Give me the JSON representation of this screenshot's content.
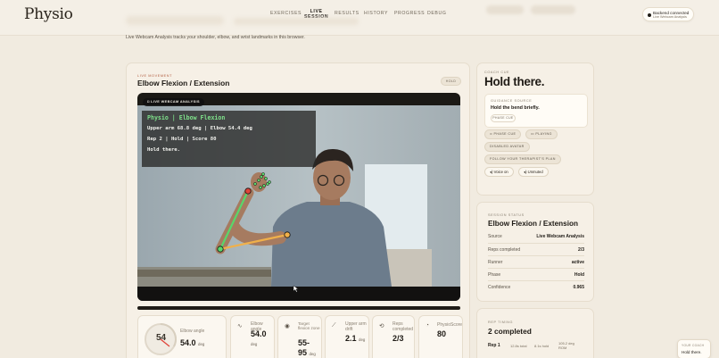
{
  "app": {
    "logo": "Physio"
  },
  "nav": {
    "items": [
      {
        "label": "EXERCISES"
      },
      {
        "label": "LIVE",
        "sub": "SESSION",
        "active": true
      },
      {
        "label": "RESULTS"
      },
      {
        "label": "HISTORY"
      },
      {
        "label": "PROGRESS"
      },
      {
        "label": "DEBUG"
      }
    ]
  },
  "backend_status": {
    "title": "Backend connected",
    "subtitle": "Live Webcam Analysis"
  },
  "intro_text": "Live Webcam Analysis tracks your shoulder, elbow, and wrist landmarks in this browser.",
  "movement": {
    "eyebrow": "LIVE MOVEMENT",
    "title": "Elbow Flexion / Extension",
    "badge": "HOLD"
  },
  "video": {
    "badge": "LIVE WEBCAM ANALYSIS",
    "overlay": {
      "title": "Physio | Elbow Flexion",
      "line1": "Upper arm 68.8 deg | Elbow 54.4 deg",
      "line2": "Rep 2 | Hold | Score 80",
      "line3": "Hold there."
    }
  },
  "metrics": {
    "elbow_angle": {
      "gauge_value": "54",
      "label": "Elbow angle",
      "value": "54.0",
      "unit": "deg"
    },
    "elbow_angle_2": {
      "label": "Elbow angle",
      "value": "54.0",
      "unit": "deg"
    },
    "target": {
      "label": "Target flexion zone",
      "value": "55-",
      "value2": "95",
      "unit": "deg"
    },
    "upper_arm_drift": {
      "label": "Upper arm drift",
      "value": "2.1",
      "unit": "deg"
    },
    "reps": {
      "label": "Reps completed",
      "value": "2/3"
    },
    "score": {
      "label": "PhysioScore",
      "value": "80"
    }
  },
  "coach": {
    "eyebrow": "COACH CUE",
    "cue": "Hold there.",
    "guidance_eyebrow": "GUIDANCE SOURCE",
    "guidance_text": "Hold the bend briefly.",
    "phase_pill": "PHASE CUE",
    "chips": {
      "phase_cue": "PHASE CUE",
      "playing": "PLAYING",
      "disabled_avatar": "DISABLED AVATAR",
      "follow_plan": "FOLLOW YOUR THERAPIST'S PLAN",
      "voice_on": "Voice on",
      "unmuted": "Unmuted"
    }
  },
  "session": {
    "eyebrow": "SESSION STATUS",
    "title": "Elbow Flexion / Extension",
    "rows": [
      {
        "k": "Source",
        "v": "Live Webcam Analysis"
      },
      {
        "k": "Reps completed",
        "v": "2/3"
      },
      {
        "k": "Runner",
        "v": "active"
      },
      {
        "k": "Phase",
        "v": "Hold"
      },
      {
        "k": "Confidence",
        "v": "0.965"
      }
    ]
  },
  "timing": {
    "eyebrow": "REP TIMING",
    "title": "2 completed",
    "rep_label": "Rep 1",
    "total": "12.8s total",
    "hold": "8.1s hold",
    "rom": "105.2 deg",
    "rom_unit": "ROM"
  },
  "mini_coach": {
    "eyebrow": "YOUR COACH",
    "text": "Hold there."
  },
  "colors": {
    "accent": "#b05a3c",
    "pose_green": "#59d66b",
    "pose_orange": "#f0b04a",
    "pose_red": "#e0443a",
    "overlay_title": "#7ee08a"
  }
}
